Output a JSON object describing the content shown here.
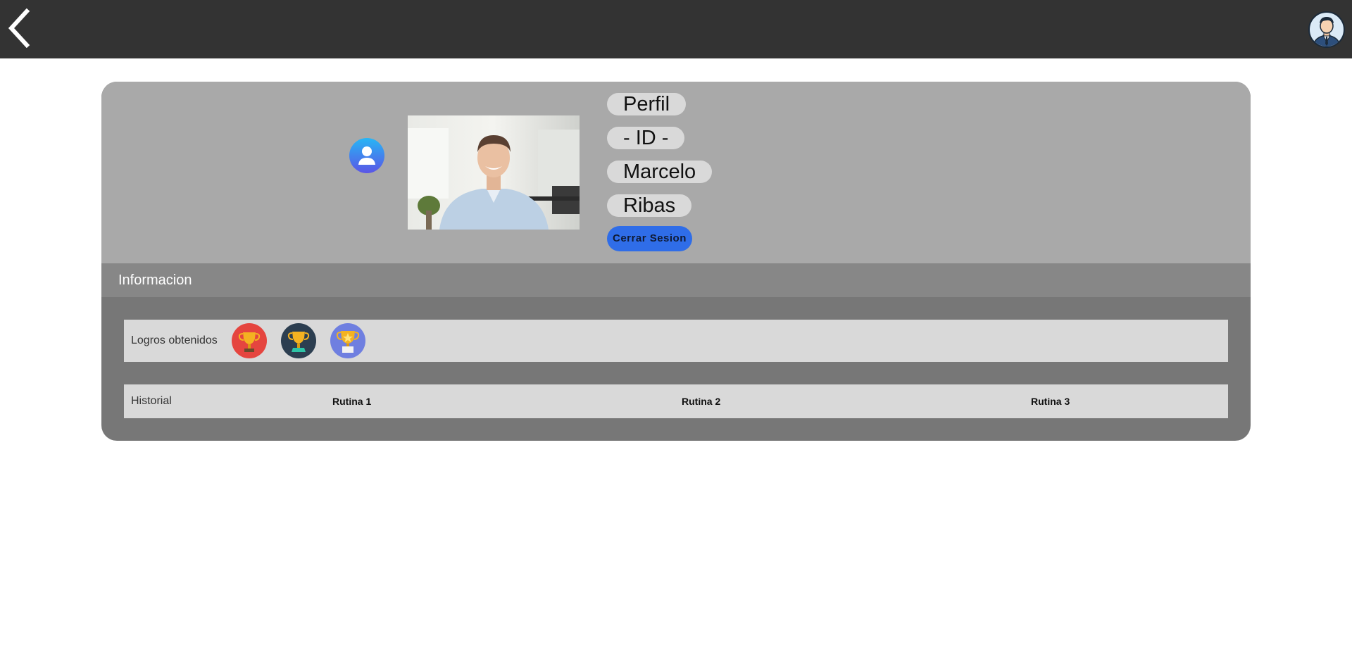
{
  "header": {
    "back_icon": "chevron-left-icon",
    "avatar_icon": "businessman-avatar-icon"
  },
  "profile": {
    "title": "Perfil",
    "id_label": "- ID -",
    "first_name": "Marcelo",
    "last_name": "Ribas",
    "logout_label": "Cerrar Sesion",
    "user_icon": "user-circle-icon",
    "photo_icon": "profile-photo"
  },
  "info": {
    "title": "Informacion",
    "achievements_label": "Logros obtenidos",
    "trophies": [
      {
        "icon": "trophy-icon",
        "color": "#e5453f"
      },
      {
        "icon": "trophy-icon",
        "color": "#2c3e50"
      },
      {
        "icon": "trophy-icon",
        "color": "#6f7fe0"
      }
    ],
    "history_label": "Historial",
    "routines": [
      "Rutina 1",
      "Rutina 2",
      "Rutina 3"
    ]
  },
  "colors": {
    "topbar": "#333333",
    "card_top": "#a9a9a9",
    "info_bar": "#878787",
    "card_body": "#777777",
    "row_bg": "#d9d9d9",
    "accent": "#2f6de8"
  }
}
